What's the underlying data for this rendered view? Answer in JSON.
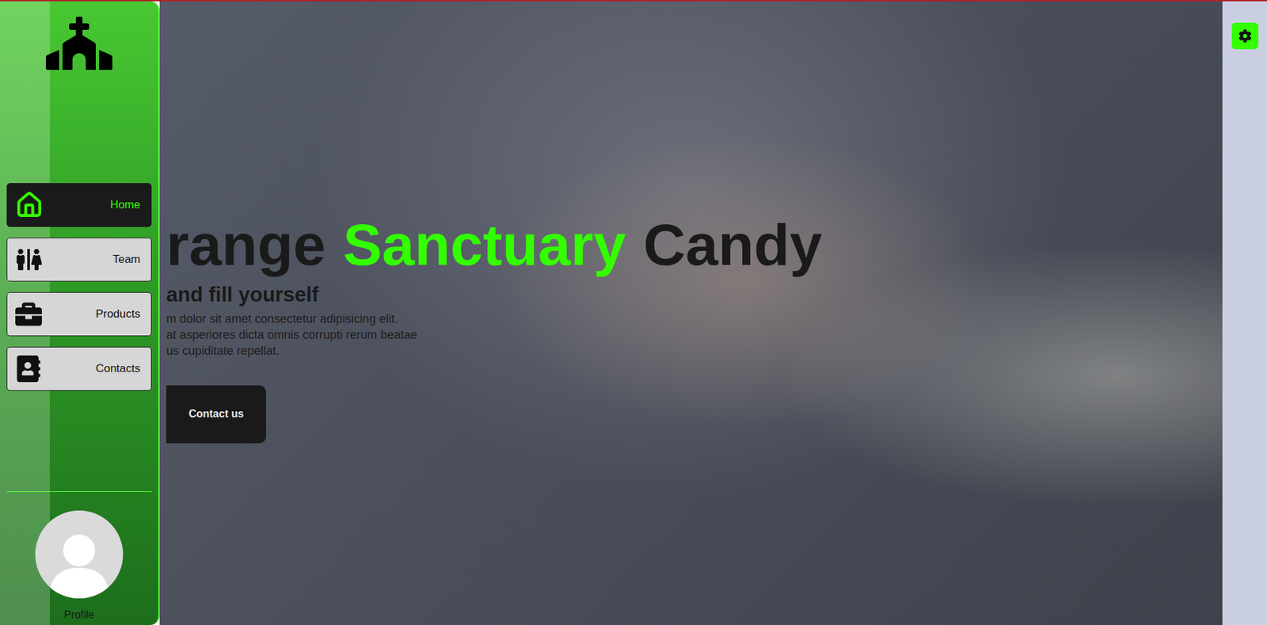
{
  "sidebar": {
    "items": [
      {
        "label": "Home",
        "selected": true
      },
      {
        "label": "Team",
        "selected": false
      },
      {
        "label": "Products",
        "selected": false
      },
      {
        "label": "Contacts",
        "selected": false
      }
    ],
    "profile": {
      "label": "Profile"
    }
  },
  "hero": {
    "title": [
      {
        "text": "range",
        "color": "#1a1a1a"
      },
      {
        "text": "Sanctuary",
        "color": "#33ff00"
      },
      {
        "text": "Candy",
        "color": "#1a1a1a"
      }
    ],
    "subtitle": "and fill yourself",
    "paragraph": [
      "m dolor sit amet consectetur adipisicing elit.",
      "at asperiores dicta omnis corrupti rerum beatae",
      "us cupiditate repellat."
    ],
    "button": "Contact us"
  }
}
